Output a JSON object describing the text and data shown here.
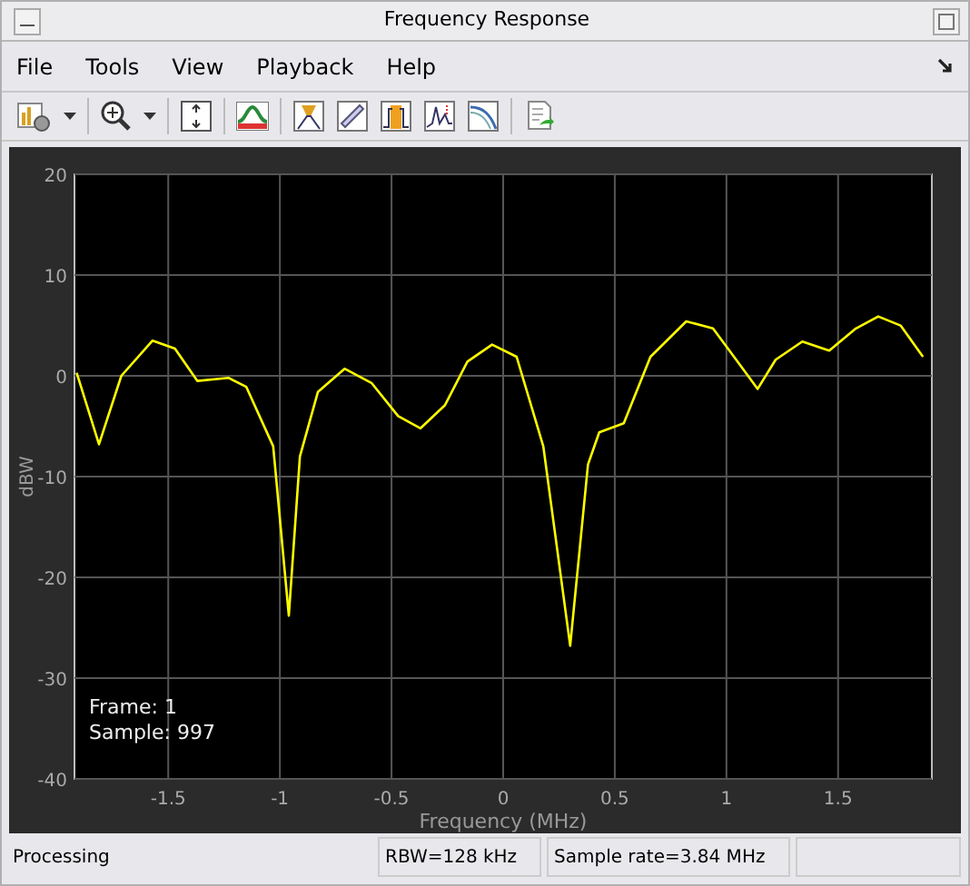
{
  "window": {
    "title": "Frequency Response"
  },
  "menu": [
    "File",
    "Tools",
    "View",
    "Playback",
    "Help"
  ],
  "plot": {
    "overlay": [
      "Frame: 1",
      "Sample: 997"
    ],
    "chart_data": {
      "type": "line",
      "xlabel": "Frequency (MHz)",
      "ylabel": "dBW",
      "xlim": [
        -1.92,
        1.92
      ],
      "ylim": [
        -40,
        20
      ],
      "xticks": [
        -1.5,
        -1,
        -0.5,
        0,
        0.5,
        1,
        1.5
      ],
      "yticks": [
        -40,
        -30,
        -20,
        -10,
        0,
        10,
        20
      ],
      "x": [
        -1.91,
        -1.81,
        -1.71,
        -1.57,
        -1.47,
        -1.37,
        -1.23,
        -1.15,
        -1.03,
        -0.96,
        -0.91,
        -0.83,
        -0.71,
        -0.59,
        -0.47,
        -0.37,
        -0.26,
        -0.16,
        -0.05,
        0.06,
        0.18,
        0.3,
        0.38,
        0.43,
        0.54,
        0.66,
        0.82,
        0.94,
        1.06,
        1.14,
        1.22,
        1.34,
        1.46,
        1.58,
        1.68,
        1.78,
        1.88
      ],
      "grid": true,
      "series": [
        {
          "color": "#ffff00",
          "values": [
            0.3,
            -6.8,
            0,
            3.5,
            2.7,
            -0.5,
            -0.2,
            -1.1,
            -7,
            -23.8,
            -8,
            -1.6,
            0.7,
            -0.7,
            -4,
            -5.2,
            -2.9,
            1.4,
            3.1,
            1.9,
            -7,
            -26.8,
            -8.8,
            -5.6,
            -4.7,
            1.9,
            5.4,
            4.7,
            1.1,
            -1.3,
            1.6,
            3.4,
            2.5,
            4.7,
            5.9,
            5,
            1.9
          ]
        }
      ]
    }
  },
  "status_bar": [
    "Processing",
    "RBW=128 kHz",
    "Sample rate=3.84 MHz"
  ]
}
